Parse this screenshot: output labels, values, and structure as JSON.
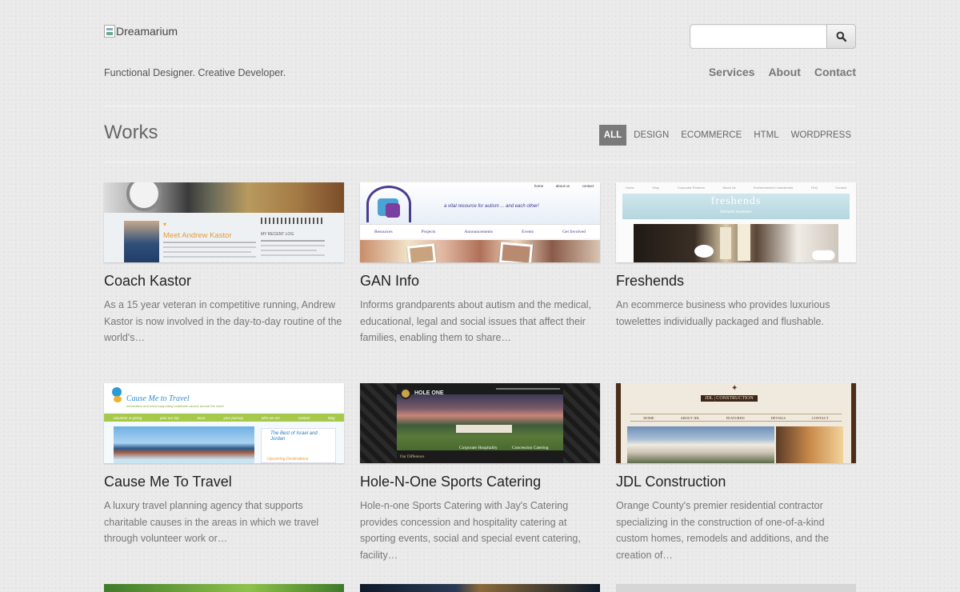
{
  "header": {
    "logo_alt": "Dreamarium",
    "tagline": "Functional Designer. Creative Developer.",
    "search": {
      "value": "",
      "placeholder": ""
    },
    "nav": [
      "Services",
      "About",
      "Contact"
    ]
  },
  "works": {
    "title": "Works",
    "filters": [
      "ALL",
      "DESIGN",
      "ECOMMERCE",
      "HTML",
      "WORDPRESS"
    ],
    "active_filter": "ALL",
    "items": [
      {
        "title": "Coach Kastor",
        "desc": "As a 15 year veteran in competitive running, Andrew Kastor is now involved in the day-to-day routine of the world's…",
        "thumb": "coach-kastor"
      },
      {
        "title": "GAN Info",
        "desc": "Informs grandparents about autism and the medical, educational, legal and social issues that affect their families, enabling them to share…",
        "thumb": "gan-info"
      },
      {
        "title": "Freshends",
        "desc": "An ecommerce business who provides luxurious towelettes individually packaged and flushable.",
        "thumb": "freshends"
      },
      {
        "title": "Cause Me To Travel",
        "desc": "A luxury travel planning agency that supports charitable causes in the areas in which we travel through volunteer work or…",
        "thumb": "cause-me-to-travel"
      },
      {
        "title": "Hole-N-One Sports Catering",
        "desc": "Hole-n-one Sports Catering with Jay's Catering provides concession and hospitality catering at sporting events, social and special event catering, facility…",
        "thumb": "hole-n-one"
      },
      {
        "title": "JDL Construction",
        "desc": "Orange County's premier residential contractor specializing in the construction of one-of-a-kind custom homes, remodels and additions, and the creation of…",
        "thumb": "jdl-construction"
      }
    ]
  },
  "thumbs": {
    "kastor": {
      "heading": "Meet Andrew Kastor",
      "side": "MY RECENT LOG"
    },
    "gan": {
      "org": "GRANDPARENT AUTISM NETWORK",
      "slogan": "a vital resource for autism ... and each other!",
      "menu": [
        "Resources",
        "Projects",
        "Announcements",
        "Events",
        "Get Involved"
      ],
      "top": [
        "home",
        "about us",
        "contact"
      ]
    },
    "freshends": {
      "logo": "freshends",
      "sub": "flushable towelettes",
      "menu": [
        "Home",
        "Shop",
        "Corporate Partners",
        "About Us",
        "Environmental Commitment",
        "FAQ",
        "Contact"
      ]
    },
    "travel": {
      "logo": "Cause Me to Travel",
      "tag": "Information and travel supporting charitable causes around the world",
      "menu": [
        "volunteer & giving",
        "plan our trip",
        "tours",
        "your journey",
        "who we are",
        "contact",
        "blog"
      ],
      "promo": "The Best of Israel and Jordan",
      "promo2": "Upcoming Destinations"
    },
    "hole": {
      "logo": "HOLE ONE",
      "labels": [
        "Corporate Hospitality",
        "Concession Catering"
      ],
      "footer": "Our Difference"
    },
    "jdl": {
      "logo": "JDL | CONSTRUCTION",
      "menu": [
        "HOME",
        "ABOUT JDL",
        "FEATURED",
        "DETAILS",
        "CONTACT"
      ]
    }
  },
  "colors": {
    "background": "#e9e9e9",
    "active_filter_bg": "#7a7a7a",
    "title": "#222222",
    "body_text": "#777777"
  },
  "icons": {
    "search_button": "search-icon",
    "logo": "broken-image-icon"
  }
}
